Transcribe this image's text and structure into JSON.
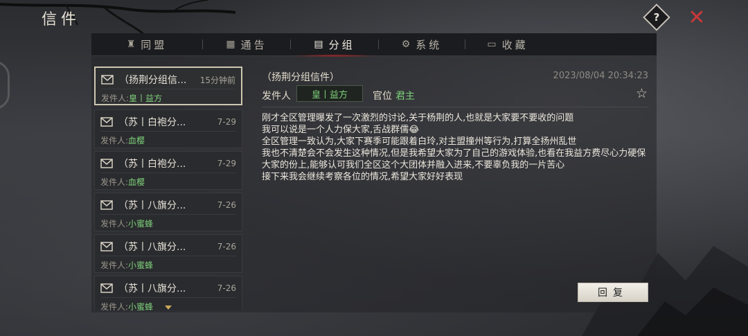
{
  "window": {
    "title": "信件"
  },
  "tabs": [
    {
      "label": "同盟",
      "icon": "alliance-icon",
      "glyph": "♜"
    },
    {
      "label": "通告",
      "icon": "announcement-icon",
      "glyph": "▦"
    },
    {
      "label": "分组",
      "icon": "group-icon",
      "glyph": "▤"
    },
    {
      "label": "系统",
      "icon": "system-gear-icon",
      "glyph": "⚙"
    },
    {
      "label": "收藏",
      "icon": "favorites-icon",
      "glyph": "▭"
    }
  ],
  "active_tab": "分组",
  "mails": [
    {
      "subject": "（扬荆分组信...",
      "time": "15分钟前",
      "sender_label": "发件人:",
      "sender": "皇丨益方"
    },
    {
      "subject": "（苏丨白袍分...",
      "time": "7-29",
      "sender_label": "发件人:",
      "sender": "血樱"
    },
    {
      "subject": "（苏丨白袍分...",
      "time": "7-29",
      "sender_label": "发件人:",
      "sender": "血樱"
    },
    {
      "subject": "（苏丨八旗分...",
      "time": "7-26",
      "sender_label": "发件人:",
      "sender": "小蜜蜂"
    },
    {
      "subject": "（苏丨八旗分...",
      "time": "7-26",
      "sender_label": "发件人:",
      "sender": "小蜜蜂"
    },
    {
      "subject": "（苏丨八旗分...",
      "time": "7-26",
      "sender_label": "发件人:",
      "sender": "小蜜蜂"
    }
  ],
  "detail": {
    "subject": "（扬荆分组信件）",
    "date": "2023/08/04 20:34:23",
    "sender_label": "发件人",
    "sender": "皇丨益方",
    "rank_label": "官位",
    "rank": "君主",
    "body": [
      "刚才全区管理曝发了一次激烈的讨论,关于杨荆的人,也就是大家要不要收的问题",
      "我可以说是一个人力保大家,舌战群儒😂",
      "全区管理一致认为,大家下赛季可能跟着白玲,对主盟撞州等行为,打算全扬州乱世",
      "我也不清楚会不会发生这种情况,但是我希望大家为了自己的游戏体验,也看在我益方费尽心力硬保大家的份上,能够认可我们全区这个大团体并融入进来,不要辜负我的一片苦心",
      "接下来我会继续考察各位的情况,希望大家好好表现"
    ]
  },
  "reply_label": "回复",
  "colors": {
    "accent_red": "#c8383a",
    "name_green": "#7ed07a",
    "selected_border": "#cfc8b2"
  }
}
